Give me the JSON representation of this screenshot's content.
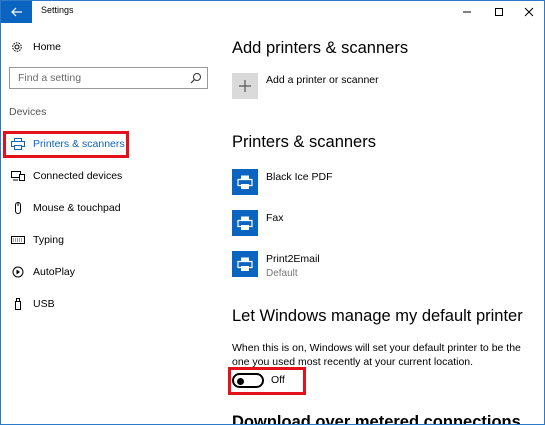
{
  "window": {
    "title": "Settings"
  },
  "sidebar": {
    "home_label": "Home",
    "search_placeholder": "Find a setting",
    "section_label": "Devices",
    "items": [
      {
        "label": "Printers & scanners",
        "icon": "printer-icon",
        "active": true
      },
      {
        "label": "Connected devices",
        "icon": "connected-devices-icon",
        "active": false
      },
      {
        "label": "Mouse & touchpad",
        "icon": "mouse-icon",
        "active": false
      },
      {
        "label": "Typing",
        "icon": "keyboard-icon",
        "active": false
      },
      {
        "label": "AutoPlay",
        "icon": "autoplay-icon",
        "active": false
      },
      {
        "label": "USB",
        "icon": "usb-icon",
        "active": false
      }
    ]
  },
  "main": {
    "add_heading": "Add printers & scanners",
    "add_button_label": "Add a printer or scanner",
    "printers_heading": "Printers & scanners",
    "printers": [
      {
        "name": "Black Ice PDF",
        "status": ""
      },
      {
        "name": "Fax",
        "status": ""
      },
      {
        "name": "Print2Email",
        "status": "Default"
      }
    ],
    "default_heading": "Let Windows manage my default printer",
    "default_description": "When this is on, Windows will set your default printer to be the one you used most recently at your current location.",
    "toggle_state_label": "Off",
    "metered_heading": "Download over metered connections"
  },
  "colors": {
    "accent": "#0c64c1",
    "highlight": "#e3111b",
    "tile_gray": "#dadada"
  }
}
